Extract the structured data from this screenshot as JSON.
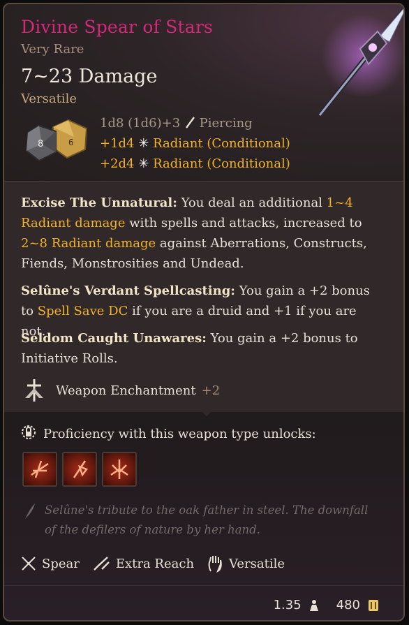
{
  "item": {
    "name": "Divine Spear of Stars",
    "rarity": "Very Rare",
    "damage": "7~23 Damage",
    "property": "Versatile",
    "dice_labels": [
      "8",
      "6"
    ]
  },
  "damage_lines": [
    {
      "dice": "1d8 (1d6)+3",
      "type": "Piercing",
      "icon": "piercing-icon"
    },
    {
      "dice": "+1d4",
      "type": "Radiant (Conditional)",
      "icon": "radiant-icon"
    },
    {
      "dice": "+2d4",
      "type": "Radiant (Conditional)",
      "icon": "radiant-icon"
    }
  ],
  "abilities": {
    "excise": {
      "name": "Excise The Unnatural:",
      "t1": " You deal an additional ",
      "h1": "1~4 Radiant damage",
      "t2": " with spells and attacks, increased to ",
      "h2": "2~8 Radiant damage",
      "t3": " against Aberrations, Constructs, Fiends, Monstrosities and Undead."
    },
    "selune": {
      "name": "Selûne's Verdant Spellcasting:",
      "t1": " You gain a +2 bonus to ",
      "h1": "Spell Save DC",
      "t2": " if you are a druid and +1 if you are not."
    },
    "seldom": {
      "name": "Seldom Caught Unawares:",
      "t1": " You gain a +2 bonus to Initiative Rolls."
    }
  },
  "enchantment": {
    "label": "Weapon Enchantment",
    "value": "+2",
    "icon": "enchantment-icon"
  },
  "proficiency": {
    "label": "Proficiency with this weapon type unlocks:",
    "icon": "proficiency-lock-icon",
    "unlocks": [
      "action-icon-1",
      "action-icon-2",
      "action-icon-3"
    ]
  },
  "flavor": "Selûne's tribute to the oak father in steel. The downfall of the defilers of nature by her hand.",
  "properties": [
    {
      "label": "Spear",
      "icon": "spear-icon"
    },
    {
      "label": "Extra Reach",
      "icon": "extra-reach-icon"
    },
    {
      "label": "Versatile",
      "icon": "versatile-hand-icon"
    }
  ],
  "stats": {
    "weight": "1.35",
    "value": "480"
  },
  "colors": {
    "title": "#d4287a",
    "highlight": "#f1b22a",
    "rarity": "#a88e7b"
  }
}
